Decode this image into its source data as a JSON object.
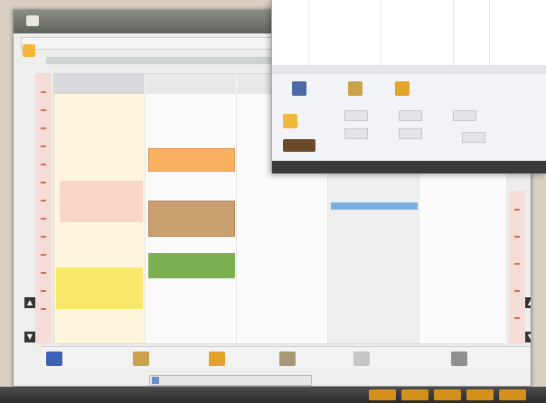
{
  "window": {
    "title": ""
  },
  "calendar": {
    "appointments": [
      {
        "id": "appt-1",
        "text": "",
        "color": "#f9b060"
      },
      {
        "id": "appt-2",
        "text": "",
        "color": "#f7d6c6"
      },
      {
        "id": "appt-3",
        "text": "",
        "color": "#c9a070"
      },
      {
        "id": "appt-4",
        "text": "",
        "color": "#7ab050"
      },
      {
        "id": "appt-5",
        "text": "",
        "color": "#f7e86a"
      },
      {
        "id": "appt-6",
        "text": "",
        "color": "#7aaee0"
      }
    ]
  },
  "bottom_toolbar": {
    "items": [
      {
        "label": "",
        "icon": "calendar-icon",
        "color": "#3d62b6"
      },
      {
        "label": "",
        "icon": "edit-icon",
        "color": "#c9a24a"
      },
      {
        "label": "",
        "icon": "bell-icon",
        "color": "#e1a428"
      },
      {
        "label": "",
        "icon": "user-icon",
        "color": "#a69a75"
      },
      {
        "label": "",
        "icon": "book-icon",
        "color": "#c6c6c6"
      },
      {
        "label": "",
        "icon": "pencil-icon",
        "color": "#8f8f8f"
      }
    ],
    "scroll_label": ""
  },
  "ribbon": {
    "groups": [
      {
        "label": ""
      },
      {
        "label": ""
      },
      {
        "label": ""
      }
    ],
    "small_buttons": [
      "",
      "",
      "",
      "",
      "",
      ""
    ]
  },
  "colors": {
    "titlebar_text": "#eef5c8",
    "tray": "#d6911c"
  }
}
